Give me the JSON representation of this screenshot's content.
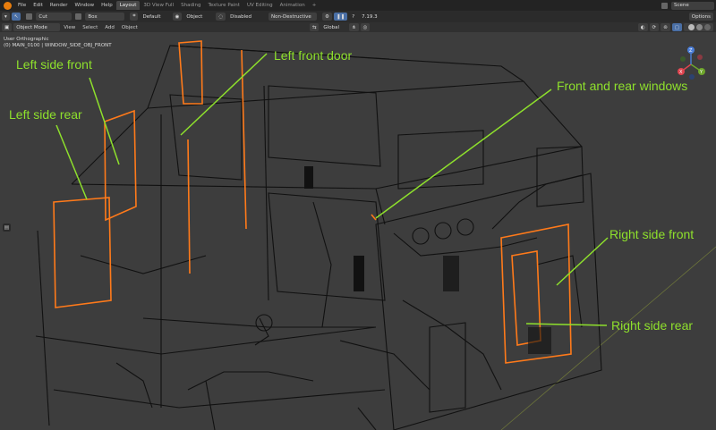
{
  "app": {
    "menus": [
      "File",
      "Edit",
      "Render",
      "Window",
      "Help"
    ],
    "workspaces": [
      "Layout",
      "3D View Full",
      "Shading",
      "Texture Paint",
      "UV Editing",
      "Animation"
    ],
    "active_workspace": "Layout",
    "add_tab": "+",
    "scene": "Scene"
  },
  "toolbar": {
    "cut": "Cut",
    "box": "Box",
    "default": "Default",
    "object": "Object",
    "disabled": "Disabled",
    "non_destructive": "Non-Destructive",
    "version": "7.19.3",
    "options": "Options"
  },
  "viewport_header": {
    "mode": "Object Mode",
    "menus": [
      "View",
      "Select",
      "Add",
      "Object"
    ],
    "transform": "Global"
  },
  "viewport": {
    "view_name": "User Orthographic",
    "object_info": "(0) MAIN_0100 | WINDOW_SIDE_OBJ_FRONT"
  },
  "callouts": {
    "left_side_front": "Left side front",
    "left_side_rear": "Left side rear",
    "left_front_door": "Left front door",
    "front_rear_windows": "Front and rear windows",
    "right_side_front": "Right side front",
    "right_side_rear": "Right side rear"
  },
  "colors": {
    "callout": "#8ee02c",
    "selection": "#ff7a1a",
    "wire": "#0d0d0d",
    "background": "#3d3d3d",
    "gizmo_x": "#e0444f",
    "gizmo_y": "#6ea62c",
    "gizmo_z": "#4c7fd9"
  },
  "gizmo": {
    "x": "X",
    "y": "Y",
    "z": "Z"
  }
}
